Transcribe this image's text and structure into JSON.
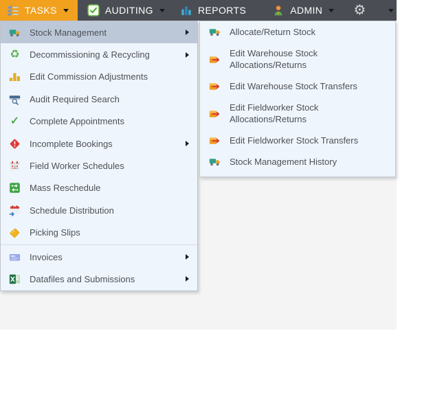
{
  "colors": {
    "bar_bg": "#4A4E54",
    "accent_orange": "#F1A11E",
    "panel_bg": "#EFF5FC",
    "highlight": "#BCC8D8",
    "content_bg": "#F4F4F5"
  },
  "menubar": {
    "items": [
      {
        "name": "tasks",
        "label": "TASKS",
        "icon": "tasks-checklist-icon",
        "active": true,
        "has_caret": true
      },
      {
        "name": "auditing",
        "label": "AUDITING",
        "icon": "auditing-checkbox-icon",
        "active": false,
        "has_caret": true
      },
      {
        "name": "reports",
        "label": "REPORTS",
        "icon": "reports-chart-icon",
        "active": false,
        "has_caret": false
      },
      {
        "name": "admin",
        "label": "ADMIN",
        "icon": "admin-user-icon",
        "active": false,
        "has_caret": true
      },
      {
        "name": "settings-gear",
        "label": "",
        "icon": "settings-gear-icon",
        "active": false,
        "has_caret": false
      },
      {
        "name": "more",
        "label": "",
        "icon": null,
        "active": false,
        "has_caret": true
      }
    ]
  },
  "tasks_menu": {
    "items": [
      {
        "label": "Stock Management",
        "icon": "truck-icon",
        "has_submenu": true,
        "highlighted": true,
        "separator_after": false
      },
      {
        "label": "Decommissioning & Recycling",
        "icon": "recycle-icon",
        "has_submenu": true,
        "highlighted": false,
        "separator_after": false
      },
      {
        "label": "Edit Commission Adjustments",
        "icon": "coins-icon",
        "has_submenu": false,
        "highlighted": false,
        "separator_after": false
      },
      {
        "label": "Audit Required Search",
        "icon": "audit-search-icon",
        "has_submenu": false,
        "highlighted": false,
        "separator_after": false
      },
      {
        "label": "Complete Appointments",
        "icon": "check-icon",
        "has_submenu": false,
        "highlighted": false,
        "separator_after": false
      },
      {
        "label": "Incomplete Bookings",
        "icon": "alert-diamond-icon",
        "has_submenu": true,
        "highlighted": false,
        "separator_after": false
      },
      {
        "label": "Field Worker Schedules",
        "icon": "calendar-icon",
        "has_submenu": false,
        "highlighted": false,
        "separator_after": false
      },
      {
        "label": "Mass Reschedule",
        "icon": "reschedule-icon",
        "has_submenu": false,
        "highlighted": false,
        "separator_after": false
      },
      {
        "label": "Schedule Distribution",
        "icon": "calendar-arrow-icon",
        "has_submenu": false,
        "highlighted": false,
        "separator_after": false
      },
      {
        "label": "Picking Slips",
        "icon": "tag-icon",
        "has_submenu": false,
        "highlighted": false,
        "separator_after": true
      },
      {
        "label": "Invoices",
        "icon": "invoice-icon",
        "has_submenu": true,
        "highlighted": false,
        "separator_after": false
      },
      {
        "label": "Datafiles and Submissions",
        "icon": "excel-icon",
        "has_submenu": true,
        "highlighted": false,
        "separator_after": false
      }
    ]
  },
  "stock_submenu": {
    "items": [
      {
        "label": "Allocate/Return Stock",
        "icon": "truck-icon"
      },
      {
        "label": "Edit Warehouse Stock Allocations/Returns",
        "icon": "box-arrow-icon"
      },
      {
        "label": "Edit Warehouse Stock Transfers",
        "icon": "box-arrow-icon"
      },
      {
        "label": "Edit Fieldworker Stock Allocations/Returns",
        "icon": "box-arrow-icon"
      },
      {
        "label": "Edit Fieldworker Stock Transfers",
        "icon": "box-arrow-icon"
      },
      {
        "label": "Stock Management History",
        "icon": "truck-icon"
      }
    ]
  }
}
